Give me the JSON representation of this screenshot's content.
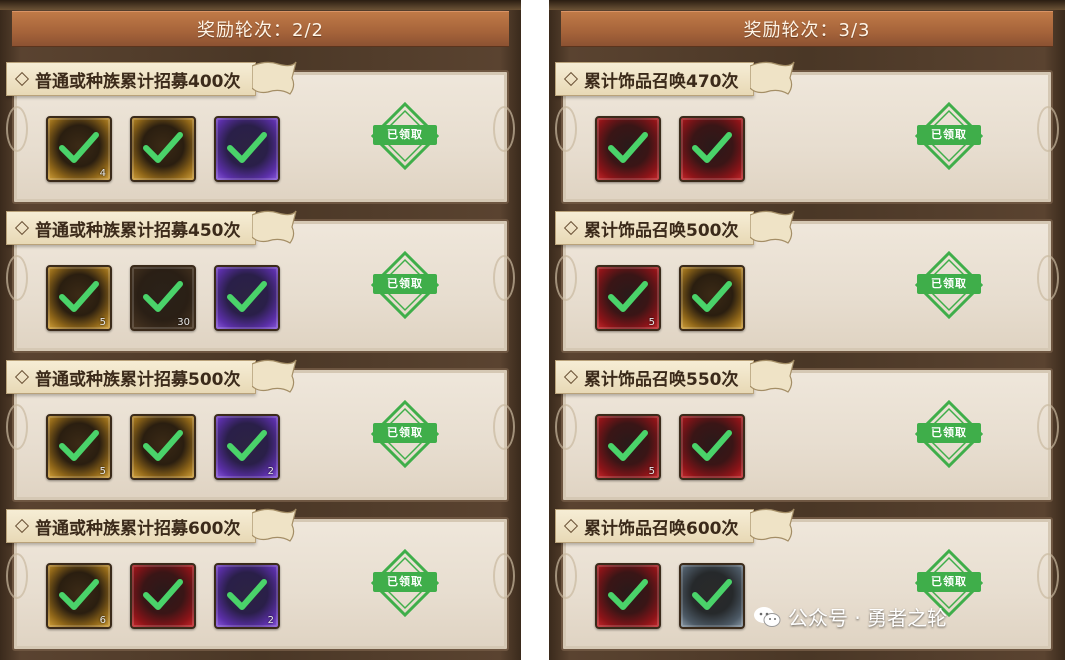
{
  "left_panel": {
    "round_label": "奖励轮次：2/2",
    "rewards": [
      {
        "title": "普通或种族累计招募400次",
        "items": [
          {
            "icon": "gold-hero-fragment-icon",
            "quality": "gold",
            "qty": "4"
          },
          {
            "icon": "gold-hero-fragment-icon",
            "quality": "gold",
            "qty": ""
          },
          {
            "icon": "purple-hero-fragment-icon",
            "quality": "purple",
            "qty": ""
          }
        ],
        "status": "已领取"
      },
      {
        "title": "普通或种族累计招募450次",
        "items": [
          {
            "icon": "gold-hero-fragment-icon",
            "quality": "gold",
            "qty": "5"
          },
          {
            "icon": "dark-material-icon",
            "quality": "dark",
            "qty": "30"
          },
          {
            "icon": "purple-hero-fragment-icon",
            "quality": "purple",
            "qty": ""
          }
        ],
        "status": "已领取"
      },
      {
        "title": "普通或种族累计招募500次",
        "items": [
          {
            "icon": "gold-hero-fragment-icon",
            "quality": "gold",
            "qty": "5"
          },
          {
            "icon": "gold-orb-icon",
            "quality": "gold",
            "qty": ""
          },
          {
            "icon": "purple-hero-fragment-icon",
            "quality": "purple",
            "qty": "2"
          }
        ],
        "status": "已领取"
      },
      {
        "title": "普通或种族累计招募600次",
        "items": [
          {
            "icon": "gold-hero-fragment-icon",
            "quality": "gold",
            "qty": "6"
          },
          {
            "icon": "red-hero-fragment-icon",
            "quality": "red",
            "qty": ""
          },
          {
            "icon": "purple-hero-fragment-icon",
            "quality": "purple",
            "qty": "2"
          }
        ],
        "status": "已领取"
      }
    ]
  },
  "right_panel": {
    "round_label": "奖励轮次：3/3",
    "rewards": [
      {
        "title": "累计饰品召唤470次",
        "items": [
          {
            "icon": "red-accessory-icon",
            "quality": "red",
            "qty": ""
          },
          {
            "icon": "red-accessory-icon",
            "quality": "red",
            "qty": ""
          }
        ],
        "status": "已领取"
      },
      {
        "title": "累计饰品召唤500次",
        "items": [
          {
            "icon": "red-accessory-icon",
            "quality": "red",
            "qty": "5"
          },
          {
            "icon": "gold-accessory-icon",
            "quality": "gold",
            "qty": ""
          }
        ],
        "status": "已领取"
      },
      {
        "title": "累计饰品召唤550次",
        "items": [
          {
            "icon": "red-accessory-icon",
            "quality": "red",
            "qty": "5"
          },
          {
            "icon": "red-accessory-icon",
            "quality": "red",
            "qty": ""
          }
        ],
        "status": "已领取"
      },
      {
        "title": "累计饰品召唤600次",
        "items": [
          {
            "icon": "red-accessory-icon",
            "quality": "red",
            "qty": ""
          },
          {
            "icon": "steel-accessory-icon",
            "quality": "steel",
            "qty": ""
          }
        ],
        "status": "已领取"
      }
    ]
  },
  "watermark": {
    "text": "公众号 · 勇者之轮",
    "icon": "wechat-icon"
  },
  "colors": {
    "header_brown": "#a5633a",
    "card_bg": "#e7ddcf",
    "stamp_green": "#3fae4a",
    "check_green": "#4ad36a"
  }
}
